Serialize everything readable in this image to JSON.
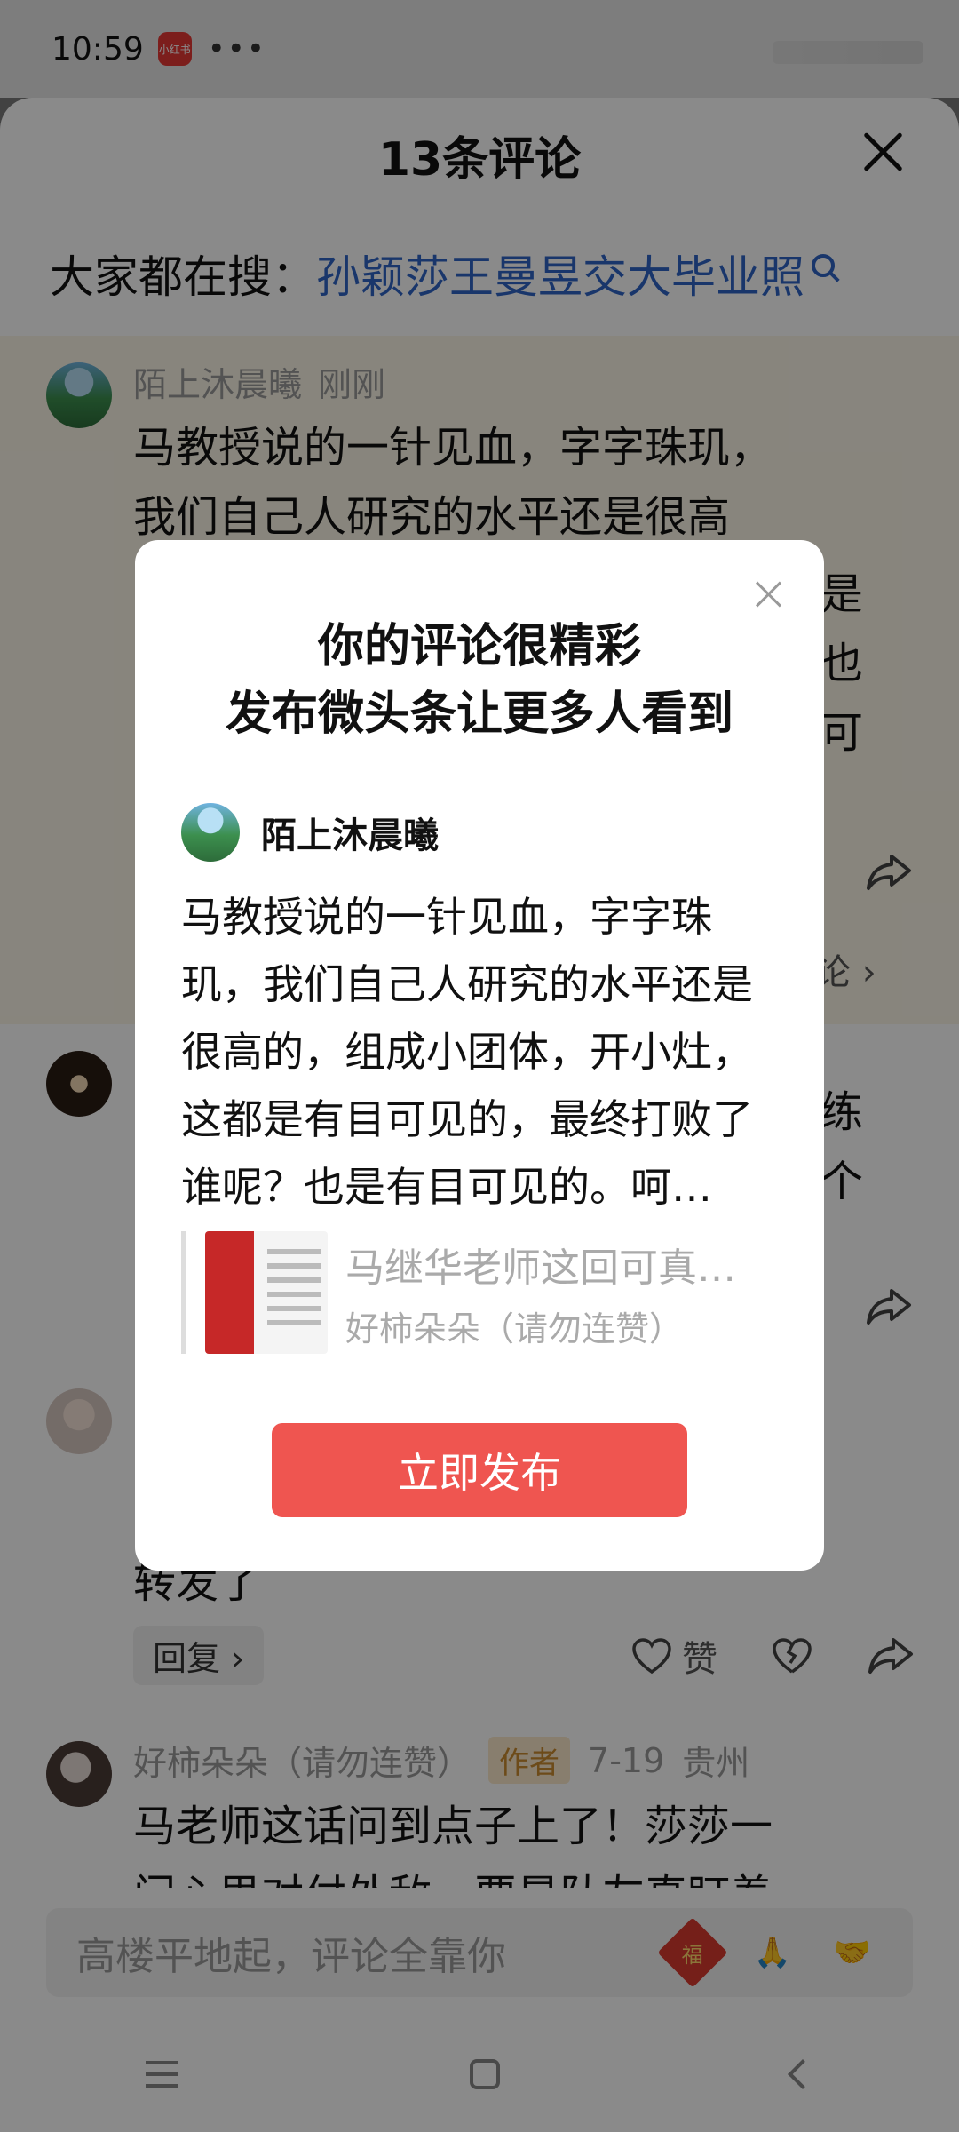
{
  "status_bar": {
    "time": "10:59",
    "app_badge": "小红书",
    "dots": "•••"
  },
  "sheet": {
    "title": "13条评论",
    "trending_label": "大家都在搜：",
    "trending_link": "孙颖莎王曼昱交大毕业照"
  },
  "comments": [
    {
      "user": "陌上沐晨曦",
      "time": "刚刚",
      "lines": [
        "马教授说的一针见血，字字珠玑，",
        "我们自己人研究的水平还是很高"
      ],
      "partial_right": [
        "是",
        "也",
        "可"
      ],
      "partial_reply_suffix": "论 ›"
    },
    {
      "partial_right": [
        "练",
        "个"
      ]
    },
    {
      "text_fragment": "转发了",
      "reply_label": "回复 ›",
      "like_label": "赞"
    },
    {
      "user": "好柿朵朵（请勿连赞）",
      "badge": "作者",
      "date": "7-19",
      "location": "贵州",
      "text": "马老师这话问到点子上了！莎莎一",
      "text2": "门心思对付外敌，要是队友真盯着"
    }
  ],
  "input": {
    "placeholder": "高楼平地起，评论全靠你"
  },
  "emojis": [
    "福",
    "🙏",
    "🤝"
  ],
  "dialog": {
    "title_line1": "你的评论很精彩",
    "title_line2": "发布微头条让更多人看到",
    "user": "陌上沐晨曦",
    "body": "马教授说的一针见血，字字珠玑，我们自己人研究的水平还是很高的，组成小团体，开小灶，这都是有目可见的，最终打败了谁呢？也是有目可见的。呵…",
    "quote_title": "马继华老师这回可真…",
    "quote_author": "好柿朵朵（请勿连赞）",
    "button": "立即发布"
  }
}
